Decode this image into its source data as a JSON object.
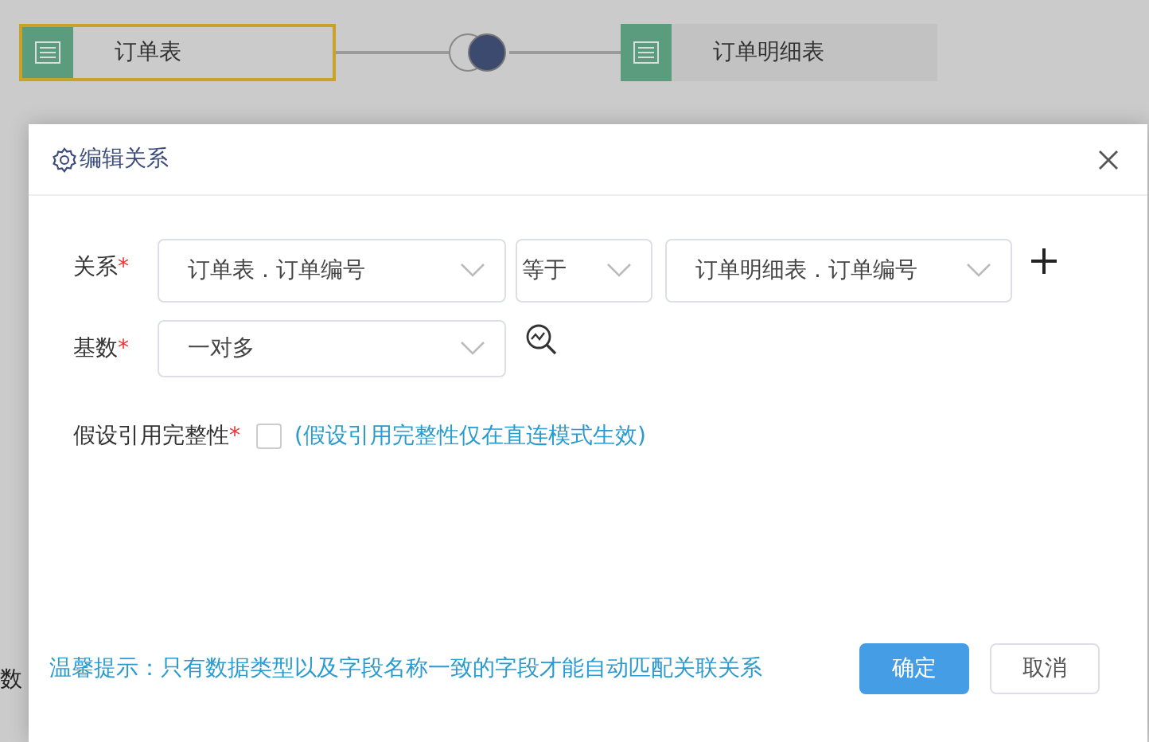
{
  "tables": [
    {
      "label": "订单表",
      "selected": true
    },
    {
      "label": "订单明细表",
      "selected": false
    }
  ],
  "background_fragment": "数",
  "dialog": {
    "title": "编辑关系",
    "relation": {
      "label": "关系",
      "mark": "*",
      "left": "订单表 . 订单编号",
      "operator": "等于",
      "right": "订单明细表 . 订单编号"
    },
    "cardinality": {
      "label": "基数",
      "mark": "*",
      "value": "一对多"
    },
    "integrity": {
      "label": "假设引用完整性",
      "mark": "*",
      "checked": false,
      "note": "(假设引用完整性仅在直连模式生效)"
    },
    "hint": "温馨提示：只有数据类型以及字段名称一致的字段才能自动匹配关联关系",
    "buttons": [
      {
        "label": "确定",
        "kind": "primary"
      },
      {
        "label": "取消",
        "kind": "secondary"
      }
    ]
  }
}
